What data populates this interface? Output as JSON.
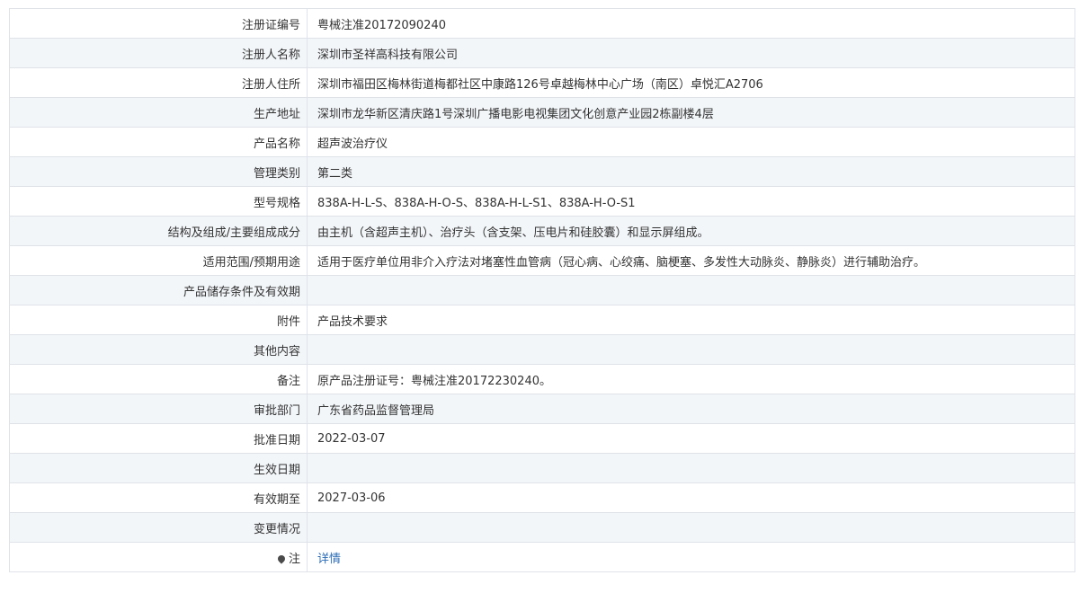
{
  "rows": [
    {
      "label": "注册证编号",
      "value": "粤械注准20172090240"
    },
    {
      "label": "注册人名称",
      "value": "深圳市圣祥高科技有限公司"
    },
    {
      "label": "注册人住所",
      "value": "深圳市福田区梅林街道梅都社区中康路126号卓越梅林中心广场（南区）卓悦汇A2706"
    },
    {
      "label": "生产地址",
      "value": "深圳市龙华新区清庆路1号深圳广播电影电视集团文化创意产业园2栋副楼4层"
    },
    {
      "label": "产品名称",
      "value": "超声波治疗仪"
    },
    {
      "label": "管理类别",
      "value": "第二类"
    },
    {
      "label": "型号规格",
      "value": "838A-H-L-S、838A-H-O-S、838A-H-L-S1、838A-H-O-S1"
    },
    {
      "label": "结构及组成/主要组成成分",
      "value": "由主机（含超声主机）、治疗头（含支架、压电片和硅胶囊）和显示屏组成。"
    },
    {
      "label": "适用范围/预期用途",
      "value": "适用于医疗单位用非介入疗法对堵塞性血管病（冠心病、心绞痛、脑梗塞、多发性大动脉炎、静脉炎）进行辅助治疗。"
    },
    {
      "label": "产品储存条件及有效期",
      "value": ""
    },
    {
      "label": "附件",
      "value": "产品技术要求"
    },
    {
      "label": "其他内容",
      "value": ""
    },
    {
      "label": "备注",
      "value": "原产品注册证号：粤械注准20172230240。"
    },
    {
      "label": "审批部门",
      "value": "广东省药品监督管理局"
    },
    {
      "label": "批准日期",
      "value": "2022-03-07"
    },
    {
      "label": "生效日期",
      "value": ""
    },
    {
      "label": "有效期至",
      "value": "2027-03-06"
    },
    {
      "label": "变更情况",
      "value": ""
    }
  ],
  "note_row": {
    "icon": "pin-icon",
    "label": "注",
    "link_text": "详情",
    "link_color": "#2b6cb5"
  }
}
